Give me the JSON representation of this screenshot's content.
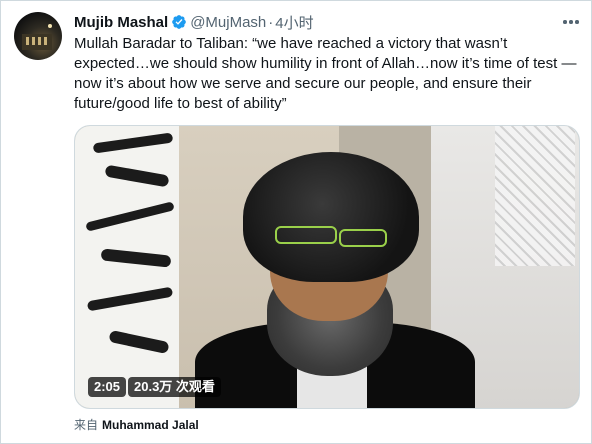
{
  "author": {
    "display_name": "Mujib Mashal",
    "handle": "@MujMash",
    "separator": "·",
    "timestamp": "4小时",
    "verified": true,
    "avatar_icon": "profile-photo"
  },
  "tweet": {
    "text": "Mullah Baradar to Taliban: “we have reached a victory that wasn’t expected…we should show humility in front of Allah…now it’s time of test — now it’s about how we serve and secure our people, and ensure their future/good life to best of ability”"
  },
  "media": {
    "duration": "2:05",
    "views": "20.3万 次观看"
  },
  "attribution": {
    "label": "来自",
    "author": "Muhammad Jalal"
  },
  "colors": {
    "text_primary": "#0f1419",
    "text_secondary": "#536471",
    "verified_blue": "#1d9bf0",
    "border": "#cfd9de"
  },
  "icons": {
    "verified": "verified-badge-icon",
    "more": "more-options-icon"
  }
}
